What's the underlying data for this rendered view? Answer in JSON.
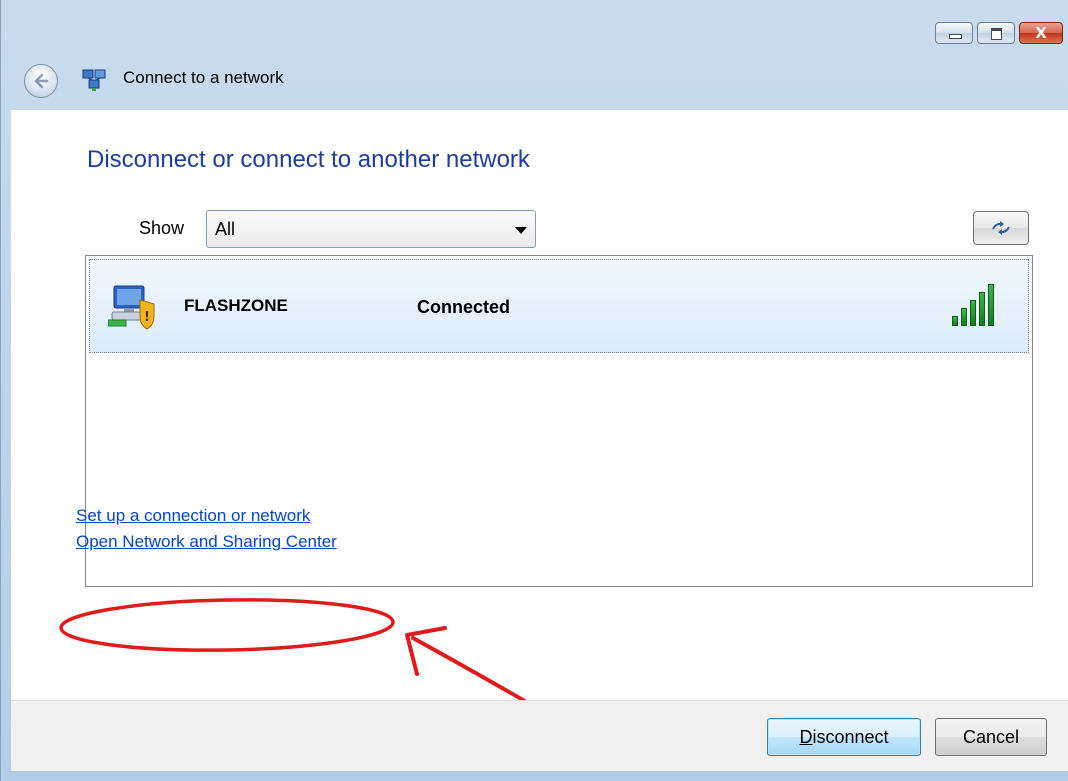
{
  "window": {
    "title": "Connect to a network",
    "controls": {
      "minimize": "minimize",
      "maximize": "maximize",
      "close": "X"
    }
  },
  "heading": "Disconnect or connect to another network",
  "filter": {
    "label": "Show",
    "selected": "All"
  },
  "networks": [
    {
      "name": "FLASHZONE",
      "status": "Connected",
      "signal_bars": 5,
      "signal_max": 5
    }
  ],
  "links": {
    "setup": "Set up a connection or network",
    "sharing_center": "Open Network and Sharing Center"
  },
  "buttons": {
    "disconnect_accel": "D",
    "disconnect_rest": "isconnect",
    "cancel": "Cancel"
  },
  "colors": {
    "heading": "#1e3c9c",
    "link": "#0645c4",
    "annotation": "#e01b1b",
    "signal": "#2a9b35"
  }
}
